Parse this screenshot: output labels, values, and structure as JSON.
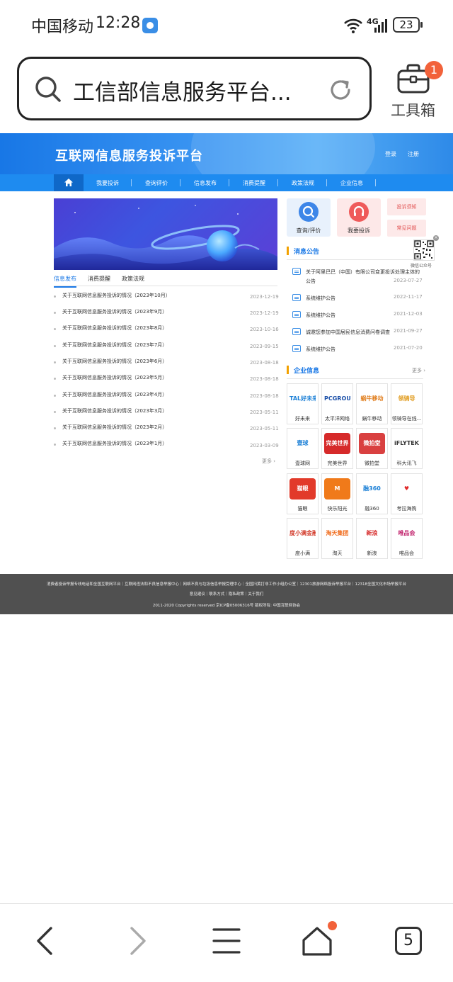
{
  "status_bar": {
    "carrier": "中国移动",
    "time": "12:28",
    "network": "4G",
    "battery": "23"
  },
  "browser": {
    "address_text": "工信部信息服务平台...",
    "toolbox_label": "工具箱",
    "toolbox_badge": "1",
    "tab_count": "5"
  },
  "site": {
    "title": "互联网信息服务投诉平台",
    "login": "登录",
    "register": "注册",
    "nav": [
      "我要投诉",
      "查询评价",
      "信息发布",
      "消费提醒",
      "政策法规",
      "企业信息"
    ],
    "news_tabs": [
      "信息发布",
      "消费提醒",
      "政策法规"
    ],
    "news": [
      {
        "title": "关于互联网信息服务投诉的情况（2023年10月）",
        "date": "2023-12-19"
      },
      {
        "title": "关于互联网信息服务投诉的情况（2023年9月）",
        "date": "2023-12-19"
      },
      {
        "title": "关于互联网信息服务投诉的情况（2023年8月）",
        "date": "2023-10-16"
      },
      {
        "title": "关于互联网信息服务投诉的情况（2023年7月）",
        "date": "2023-09-15"
      },
      {
        "title": "关于互联网信息服务投诉的情况（2023年6月）",
        "date": "2023-08-18"
      },
      {
        "title": "关于互联网信息服务投诉的情况（2023年5月）",
        "date": "2023-08-18"
      },
      {
        "title": "关于互联网信息服务投诉的情况（2023年4月）",
        "date": "2023-08-18"
      },
      {
        "title": "关于互联网信息服务投诉的情况（2023年3月）",
        "date": "2023-05-11"
      },
      {
        "title": "关于互联网信息服务投诉的情况（2023年2月）",
        "date": "2023-05-11"
      },
      {
        "title": "关于互联网信息服务投诉的情况（2023年1月）",
        "date": "2023-03-09"
      }
    ],
    "news_more": "更多",
    "quick": {
      "query": "查询/评价",
      "complain": "我要投诉",
      "guide": "投诉须知",
      "faq": "常见问题"
    },
    "qr_label": "微信公众号",
    "notices_title": "消息公告",
    "notices": [
      {
        "title": "关于阿里巴巴（中国）有限公司变更投诉处理主体的公告",
        "line1": "关于阿里巴巴（中国）有限公司变更投诉处理主体的",
        "line2": "公告",
        "date": "2023-07-27"
      },
      {
        "title": "系统维护公告",
        "date": "2022-11-17"
      },
      {
        "title": "系统维护公告",
        "date": "2021-12-03"
      },
      {
        "title": "诚邀您参加中国居民信息消费问卷调查",
        "date": "2021-09-27"
      },
      {
        "title": "系统维护公告",
        "date": "2021-07-20"
      }
    ],
    "companies_title": "企业信息",
    "companies_more": "更多",
    "companies": [
      {
        "name": "好未来",
        "logo": "TAL好未来",
        "color": "#1a7fd6",
        "bg": "#ffffff"
      },
      {
        "name": "太平洋网络",
        "logo": "PCGROUP",
        "color": "#1a4fa8",
        "bg": "#ffffff"
      },
      {
        "name": "蜗牛移动",
        "logo": "蜗牛移动",
        "color": "#e07c1a",
        "bg": "#ffffff"
      },
      {
        "name": "领骑导在线...",
        "logo": "领骑导",
        "color": "#e09a1a",
        "bg": "#ffffff"
      },
      {
        "name": "壹球网",
        "logo": "壹球",
        "color": "#1a7fd6",
        "bg": "#ffffff"
      },
      {
        "name": "完美世界",
        "logo": "完美世界",
        "color": "#ffffff",
        "bg": "#d62a2a"
      },
      {
        "name": "微拍堂",
        "logo": "微拍堂",
        "color": "#ffffff",
        "bg": "#d94040"
      },
      {
        "name": "科大讯飞",
        "logo": "iFLYTEK",
        "color": "#333333",
        "bg": "#ffffff"
      },
      {
        "name": "猫眼",
        "logo": "猫眼",
        "color": "#ffffff",
        "bg": "#e23a2a"
      },
      {
        "name": "快乐阳光",
        "logo": "M",
        "color": "#ffffff",
        "bg": "#f07a1a"
      },
      {
        "name": "融360",
        "logo": "融360",
        "color": "#1a7fd6",
        "bg": "#ffffff"
      },
      {
        "name": "考拉海购",
        "logo": "♥",
        "color": "#e02a2a",
        "bg": "#ffffff"
      },
      {
        "name": "度小满",
        "logo": "度小满金融",
        "color": "#d23a2a",
        "bg": "#ffffff"
      },
      {
        "name": "淘天",
        "logo": "淘天集团",
        "color": "#f06a1a",
        "bg": "#ffffff"
      },
      {
        "name": "新浪",
        "logo": "新浪",
        "color": "#d62a2a",
        "bg": "#ffffff"
      },
      {
        "name": "唯品会",
        "logo": "唯品会",
        "color": "#c2256e",
        "bg": "#ffffff"
      }
    ],
    "footer": {
      "line1": "消费者投诉举报专线电话和全国互联网平台｜互联网违法和不良信息举报中心｜网络不良与垃圾信息举报受理中心｜全国扫黄打非工作小组办公室｜12301旅游网络投诉举报平台｜12318全国文化市场举报平台",
      "line2": "意见建议｜联系方式｜隐私政策｜关于我们",
      "line3": "2011-2020 Copyrights reserved 京ICP备05006316号 版权所有: 中国互联网协会"
    }
  },
  "colors": {
    "brand_blue": "#1877e6",
    "nav_blue": "#1e8bf0",
    "accent_orange": "#f2623a",
    "footer_gray": "#505050"
  }
}
